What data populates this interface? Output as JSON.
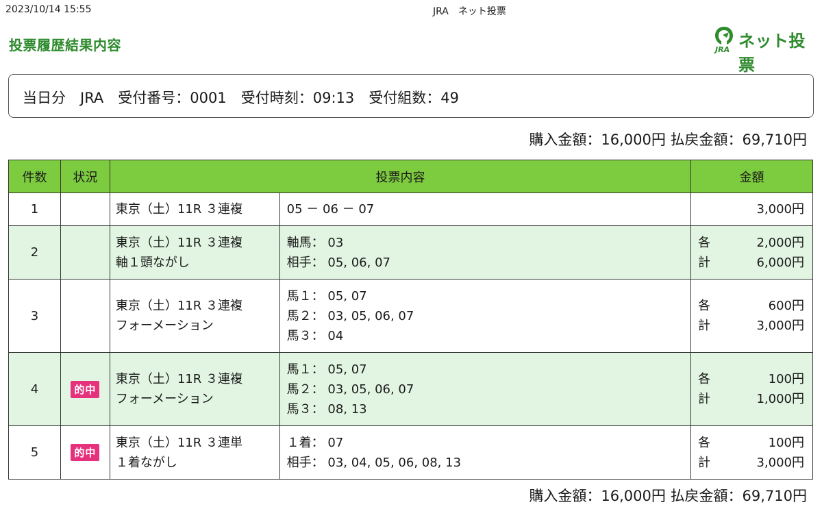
{
  "header": {
    "datetime": "2023/10/14 15:55",
    "site_title": "JRA　ネット投票",
    "page_title": "投票履歴結果内容"
  },
  "logo": {
    "text": "ネット投票",
    "sub": "JRA",
    "color": "#2e8b2e"
  },
  "summary": {
    "line": "当日分　JRA　受付番号：0001　受付時刻：09:13　受付組数：49"
  },
  "totals": {
    "line": "購入金額：16,000円 払戻金額：69,710円"
  },
  "table": {
    "headers": [
      "件数",
      "状況",
      "投票内容",
      "金額"
    ],
    "rows": [
      {
        "count": "1",
        "status": "",
        "race": [
          "東京（土）11R ３連複"
        ],
        "detail": [
          "05 － 06 － 07"
        ],
        "amount": [
          {
            "label": "",
            "value": "3,000円"
          }
        ]
      },
      {
        "count": "2",
        "status": "",
        "race": [
          "東京（土）11R ３連複",
          "軸１頭ながし"
        ],
        "detail": [
          "軸馬： 03",
          "相手： 05, 06, 07"
        ],
        "amount": [
          {
            "label": "各",
            "value": "2,000円"
          },
          {
            "label": "計",
            "value": "6,000円"
          }
        ]
      },
      {
        "count": "3",
        "status": "",
        "race": [
          "東京（土）11R ３連複",
          "フォーメーション"
        ],
        "detail": [
          "馬１： 05, 07",
          "馬２： 03, 05, 06, 07",
          "馬３： 04"
        ],
        "amount": [
          {
            "label": "各",
            "value": "600円"
          },
          {
            "label": "計",
            "value": "3,000円"
          }
        ]
      },
      {
        "count": "4",
        "status": "的中",
        "race": [
          "東京（土）11R ３連複",
          "フォーメーション"
        ],
        "detail": [
          "馬１： 05, 07",
          "馬２： 03, 05, 06, 07",
          "馬３： 08, 13"
        ],
        "amount": [
          {
            "label": "各",
            "value": "100円"
          },
          {
            "label": "計",
            "value": "1,000円"
          }
        ]
      },
      {
        "count": "5",
        "status": "的中",
        "race": [
          "東京（土）11R ３連単",
          "１着ながし"
        ],
        "detail": [
          "１着： 07",
          "相手： 03, 04, 05, 06, 08, 13"
        ],
        "amount": [
          {
            "label": "各",
            "value": "100円"
          },
          {
            "label": "計",
            "value": "3,000円"
          }
        ]
      }
    ]
  },
  "colors": {
    "header_bg": "#7dcc3f",
    "shade_bg": "#e2f5e2",
    "hit_badge": "#e6317c",
    "title_green": "#2e8b2e"
  }
}
